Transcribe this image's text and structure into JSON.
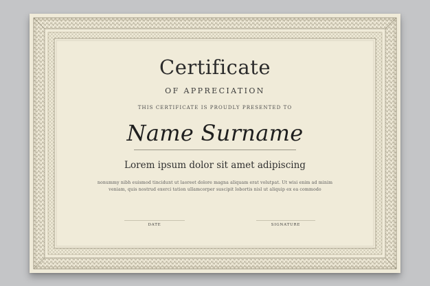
{
  "certificate": {
    "title": "Certificate",
    "subtitle": "OF APPRECIATION",
    "presented_line": "THIS CERTIFICATE IS PROUDLY PRESENTED TO",
    "recipient_name": "Name Surname",
    "lead_text": "Lorem ipsum dolor sit amet adipiscing",
    "body_line_1": "nonummy nibh euismod tincidunt ut laoreet dolore magna aliquam erat volutpat. Ut wisi enim ad minim",
    "body_line_2": "veniam, quis nostrud exerci tation ullamcorper suscipit lobortis nisl ut aliquip ex ea commodo",
    "date_label": "DATE",
    "signature_label": "SIGNATURE"
  },
  "colors": {
    "background": "#c4c5c7",
    "paper": "#f0ebd9",
    "border_ornament": "#8c8570",
    "text": "#2b2b2b"
  }
}
